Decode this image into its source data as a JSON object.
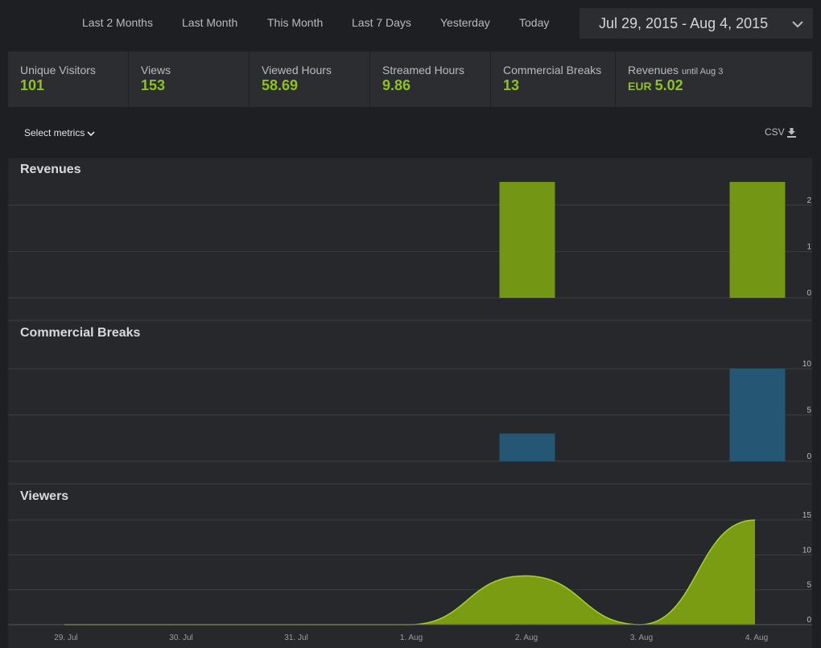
{
  "range_tabs": [
    "Last 2 Months",
    "Last Month",
    "This Month",
    "Last 7 Days",
    "Yesterday",
    "Today"
  ],
  "date_picker": {
    "label": "Jul 29, 2015 - Aug 4, 2015",
    "icon": "chevron-down-icon"
  },
  "stats": [
    {
      "title": "Unique Visitors",
      "value": "101"
    },
    {
      "title": "Views",
      "value": "153"
    },
    {
      "title": "Viewed Hours",
      "value": "58.69"
    },
    {
      "title": "Streamed Hours",
      "value": "9.86"
    },
    {
      "title": "Commercial Breaks",
      "value": "13"
    },
    {
      "title": "Revenues",
      "note": "until Aug 3",
      "currency": "EUR",
      "value": "5.02"
    }
  ],
  "controls": {
    "select_metrics": "Select metrics",
    "csv": "CSV",
    "csv_icon": "download-icon"
  },
  "colors": {
    "accent_green": "#8ec21f",
    "bar_green": "#739614",
    "bar_blue": "#255673",
    "area_green": "#7a9c12"
  },
  "chart_data": [
    {
      "type": "bar",
      "title": "Revenues",
      "categories": [
        "29. Jul",
        "30. Jul",
        "31. Jul",
        "1. Aug",
        "2. Aug",
        "3. Aug",
        "4. Aug"
      ],
      "values": [
        0,
        0,
        0,
        0,
        2.5,
        0,
        2.5
      ],
      "ylim": [
        0,
        2.5
      ],
      "yticks": [
        "0",
        "1",
        "2"
      ],
      "grid": true
    },
    {
      "type": "bar",
      "title": "Commercial Breaks",
      "categories": [
        "29. Jul",
        "30. Jul",
        "31. Jul",
        "1. Aug",
        "2. Aug",
        "3. Aug",
        "4. Aug"
      ],
      "values": [
        0,
        0,
        0,
        0,
        3,
        0,
        10
      ],
      "ylim": [
        0,
        10
      ],
      "yticks": [
        "0",
        "5",
        "10"
      ],
      "grid": true
    },
    {
      "type": "area",
      "title": "Viewers",
      "x": [
        "29. Jul",
        "30. Jul",
        "31. Jul",
        "1. Aug",
        "2. Aug",
        "3. Aug",
        "4. Aug"
      ],
      "values": [
        0,
        0,
        0,
        0,
        7,
        0,
        15
      ],
      "ylim": [
        0,
        15
      ],
      "yticks": [
        "0",
        "5",
        "10",
        "15"
      ],
      "xticks": [
        "29. Jul",
        "30. Jul",
        "31. Jul",
        "1. Aug",
        "2. Aug",
        "3. Aug",
        "4. Aug"
      ],
      "grid": true
    }
  ]
}
